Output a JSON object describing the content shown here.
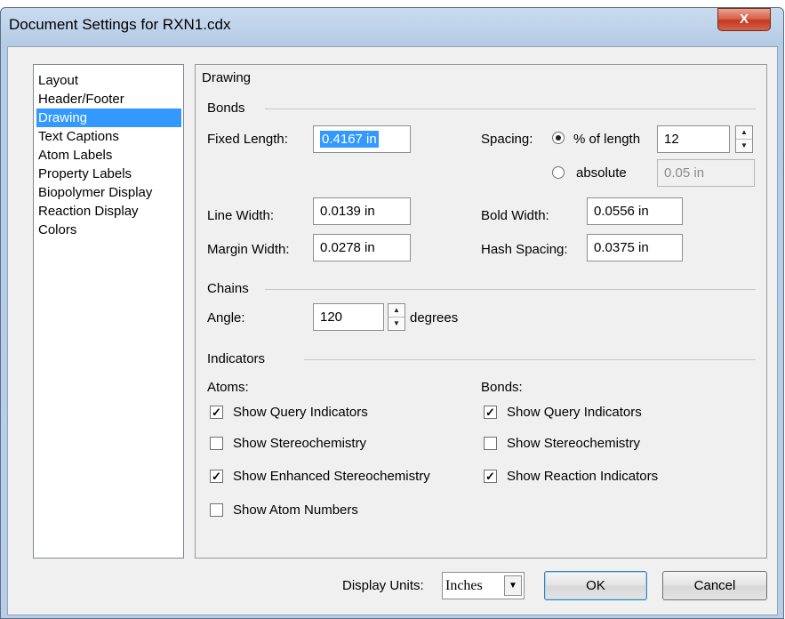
{
  "window": {
    "title": "Document Settings for RXN1.cdx",
    "close_label": "X"
  },
  "sidebar": {
    "items": [
      {
        "label": "Layout"
      },
      {
        "label": "Header/Footer"
      },
      {
        "label": "Drawing",
        "selected": true
      },
      {
        "label": "Text Captions"
      },
      {
        "label": "Atom Labels"
      },
      {
        "label": "Property Labels"
      },
      {
        "label": "Biopolymer Display"
      },
      {
        "label": "Reaction Display"
      },
      {
        "label": "Colors"
      }
    ]
  },
  "panel": {
    "title": "Drawing",
    "bonds": {
      "heading": "Bonds",
      "fixed_length_label": "Fixed Length:",
      "fixed_length_value": "0.4167 in",
      "spacing_label": "Spacing:",
      "percent_label": "% of length",
      "percent_value": "12",
      "absolute_label": "absolute",
      "absolute_value": "0.05 in",
      "line_width_label": "Line Width:",
      "line_width_value": "0.0139 in",
      "bold_width_label": "Bold Width:",
      "bold_width_value": "0.0556 in",
      "margin_width_label": "Margin Width:",
      "margin_width_value": "0.0278 in",
      "hash_spacing_label": "Hash Spacing:",
      "hash_spacing_value": "0.0375 in"
    },
    "chains": {
      "heading": "Chains",
      "angle_label": "Angle:",
      "angle_value": "120",
      "degrees_label": "degrees"
    },
    "indicators": {
      "heading": "Indicators",
      "atoms_label": "Atoms:",
      "bonds_label": "Bonds:",
      "atoms": [
        {
          "label": "Show Query Indicators",
          "checked": true
        },
        {
          "label": "Show Stereochemistry",
          "checked": false
        },
        {
          "label": "Show Enhanced Stereochemistry",
          "checked": true
        },
        {
          "label": "Show Atom Numbers",
          "checked": false
        }
      ],
      "bonds": [
        {
          "label": "Show Query Indicators",
          "checked": true
        },
        {
          "label": "Show Stereochemistry",
          "checked": false
        },
        {
          "label": "Show Reaction Indicators",
          "checked": true
        }
      ]
    }
  },
  "footer": {
    "display_units_label": "Display Units:",
    "display_units_value": "Inches",
    "ok_label": "OK",
    "cancel_label": "Cancel"
  }
}
